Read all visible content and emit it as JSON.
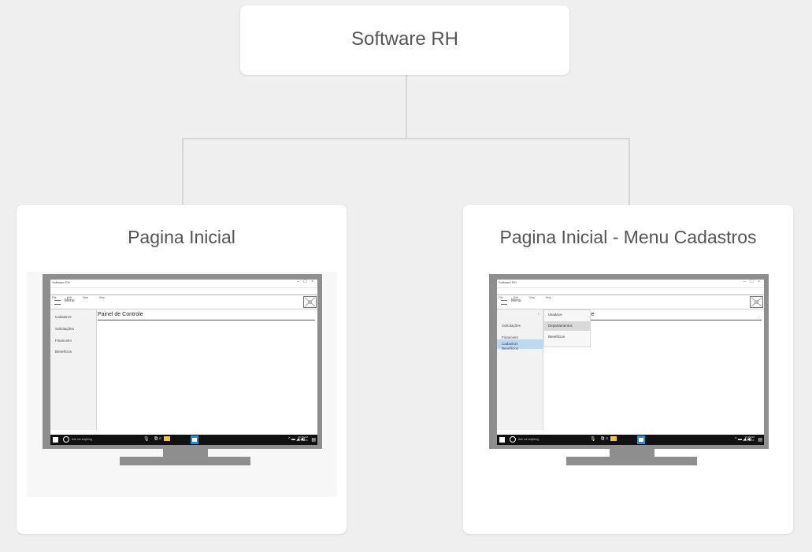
{
  "root": {
    "title": "Software RH"
  },
  "cards": [
    {
      "title": "Pagina Inicial",
      "app": {
        "window_title": "Software RH",
        "window_controls": "– ☐ ×",
        "menu_items": [
          "File",
          "Edit",
          "View",
          "Help"
        ],
        "hamburger_label": "Menu",
        "sidebar": [
          "Cadastros",
          "Solicitações",
          "Financeiro",
          "Benefícios"
        ],
        "content_title": "Painel de Controle",
        "taskbar_search": "Ask me anything",
        "tray_time": "10:15 AM",
        "tray_date": "4/3/2016"
      }
    },
    {
      "title": "Pagina Inicial - Menu Cadastros",
      "app": {
        "window_title": "Software RH",
        "window_controls": "– ☐ ×",
        "menu_items": [
          "File",
          "Edit",
          "View",
          "Help"
        ],
        "hamburger_label": "Menu",
        "sidebar": [
          "Cadastros",
          "Solicitações",
          "Financeiro",
          "Benefícios"
        ],
        "content_title_partial": "le",
        "dropdown": [
          "Usuários",
          "Departamentos",
          "Benefícios"
        ],
        "taskbar_search": "Ask me anything",
        "tray_time": "10:15 AM",
        "tray_date": "4/3/2016"
      }
    }
  ],
  "colors": {
    "background": "#efefef",
    "card": "#ffffff",
    "connector": "#d6d6d6",
    "monitor": "#8e8e8e",
    "highlight": "#bcd8f2"
  }
}
